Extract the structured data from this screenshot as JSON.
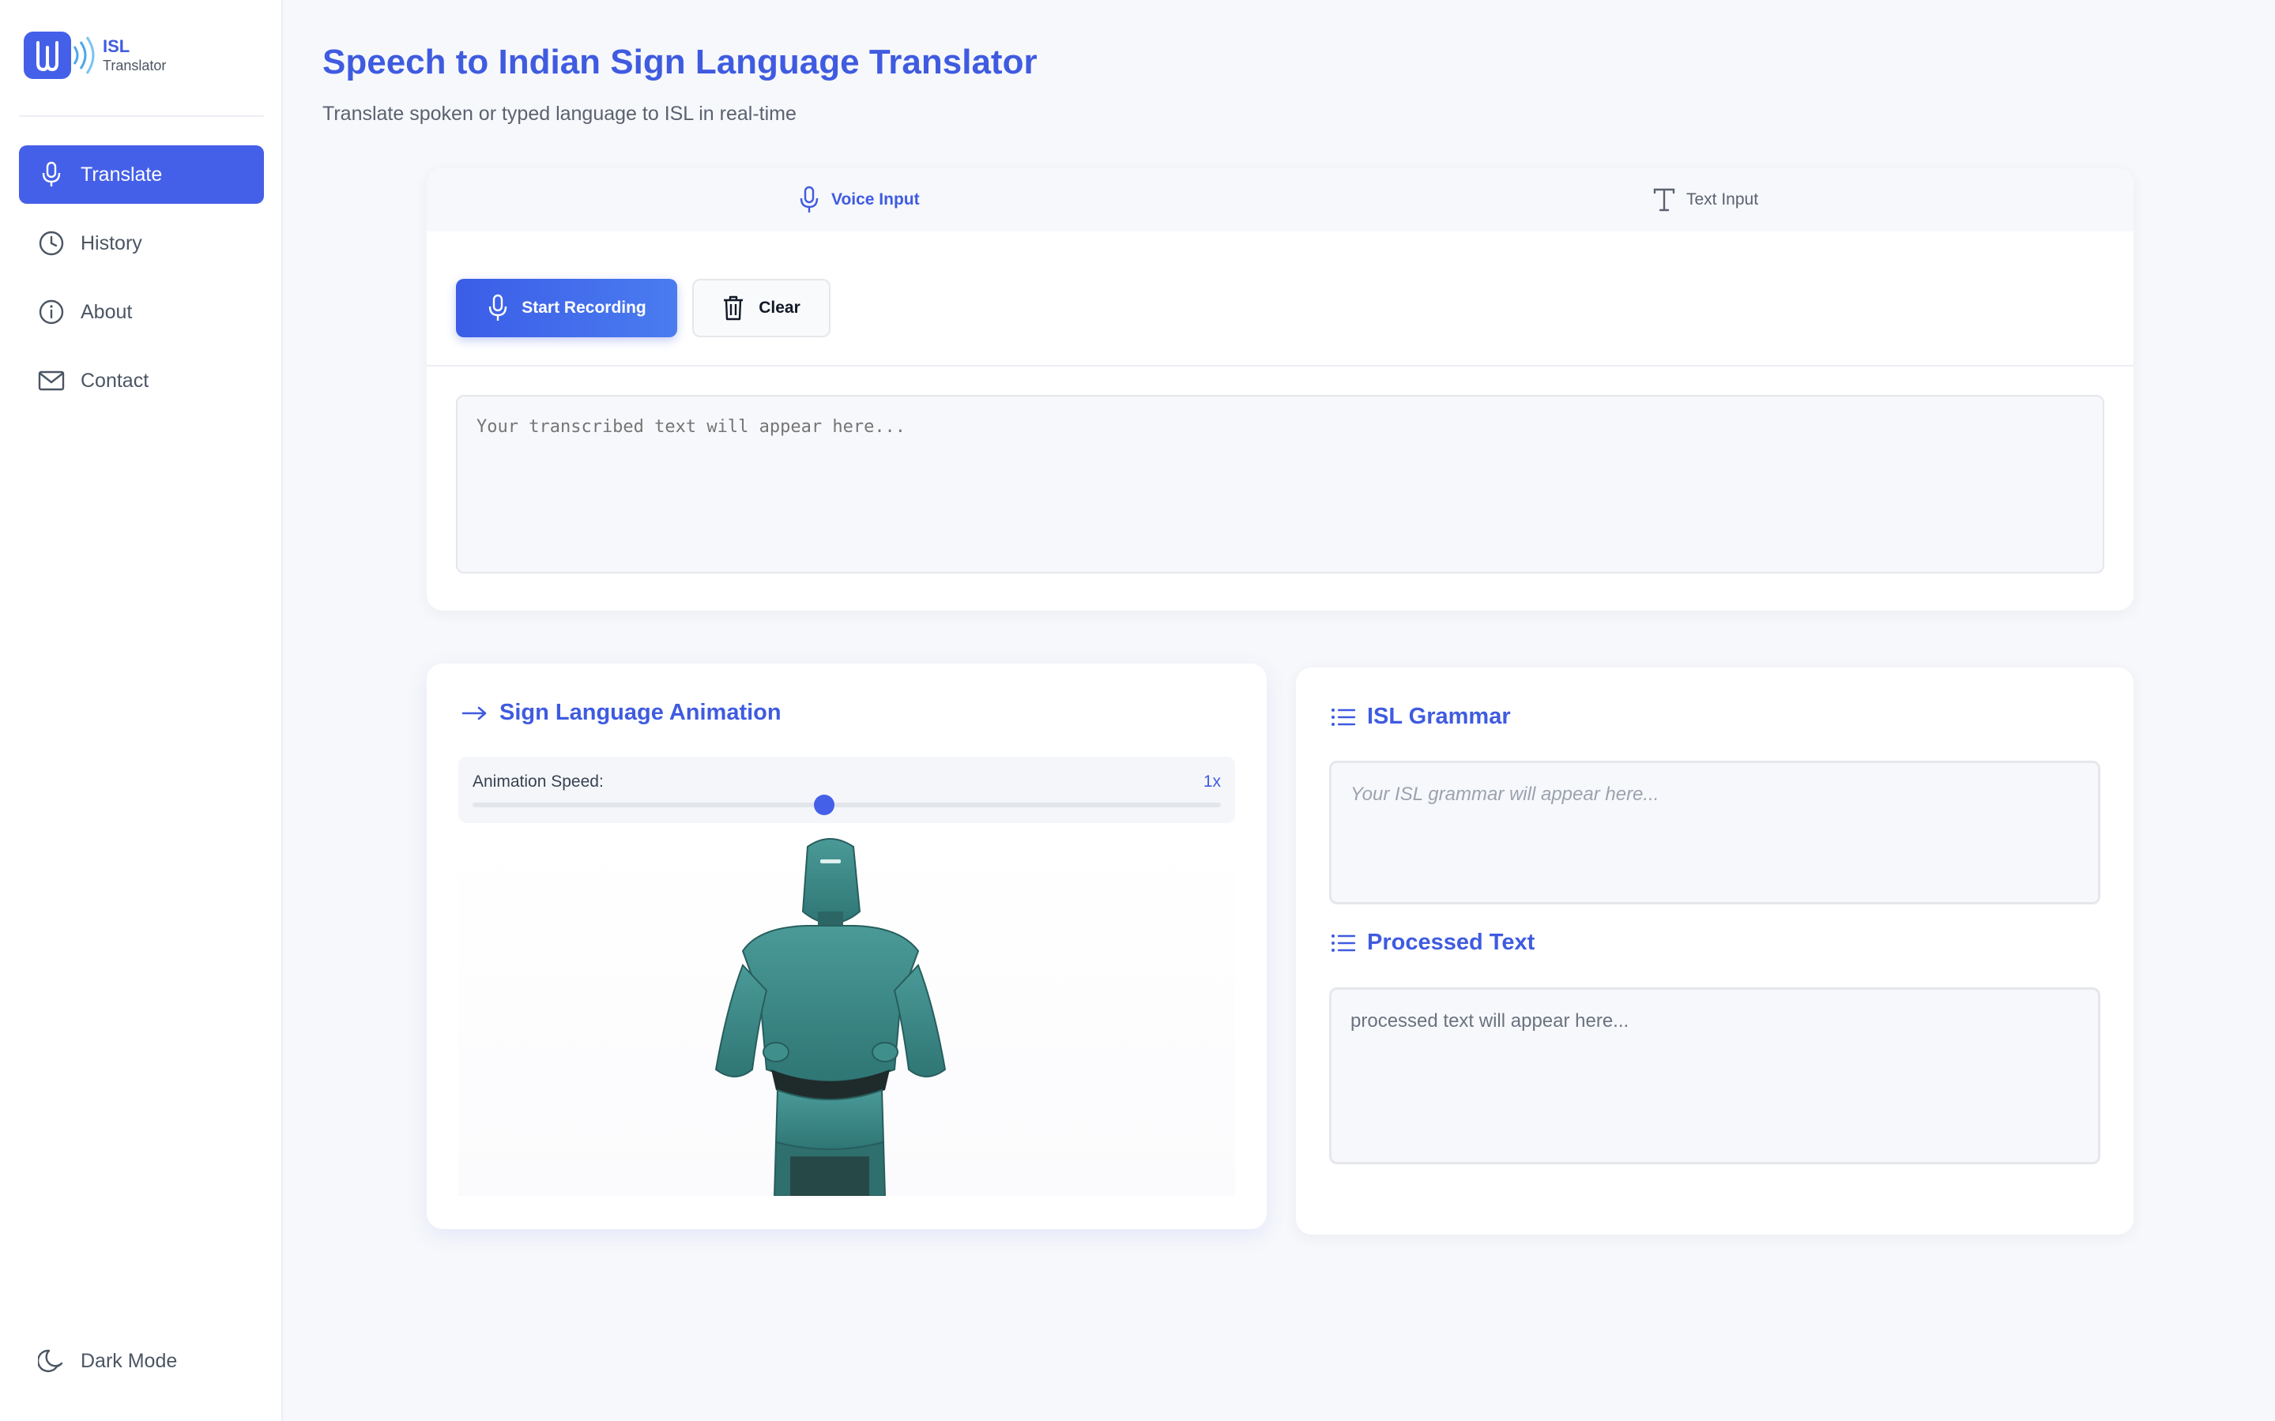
{
  "app": {
    "logo_title": "ISL",
    "logo_subtitle": "Translator"
  },
  "sidebar": {
    "items": [
      {
        "label": "Translate",
        "icon": "microphone-icon",
        "active": true
      },
      {
        "label": "History",
        "icon": "clock-icon",
        "active": false
      },
      {
        "label": "About",
        "icon": "info-icon",
        "active": false
      },
      {
        "label": "Contact",
        "icon": "mail-icon",
        "active": false
      }
    ],
    "dark_mode_label": "Dark Mode"
  },
  "header": {
    "title": "Speech to Indian Sign Language Translator",
    "subtitle": "Translate spoken or typed language to ISL in real-time"
  },
  "input_card": {
    "tabs": [
      {
        "label": "Voice Input",
        "active": true
      },
      {
        "label": "Text Input",
        "active": false
      }
    ],
    "record_label": "Start Recording",
    "clear_label": "Clear",
    "transcript_placeholder": "Your transcribed text will appear here..."
  },
  "animation": {
    "title": "Sign Language Animation",
    "speed_label": "Animation Speed:",
    "speed_value": "1x",
    "speed_fraction": 0.47
  },
  "grammar": {
    "title": "ISL Grammar",
    "placeholder": "Your ISL grammar will appear here...",
    "processed_title": "Processed Text",
    "processed_placeholder": "processed text will appear here..."
  },
  "colors": {
    "accent": "#4560e8",
    "avatar": "#3f8f8d"
  }
}
